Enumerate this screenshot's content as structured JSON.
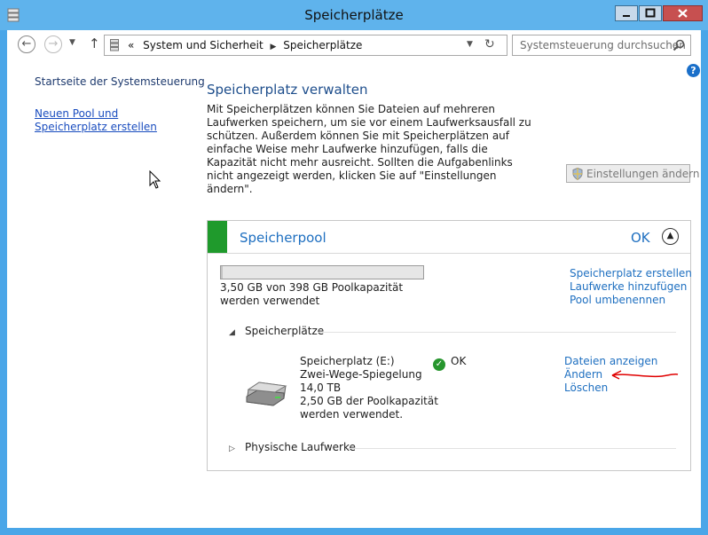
{
  "window": {
    "title": "Speicherplätze"
  },
  "nav": {
    "breadcrumb_prefix": "«",
    "breadcrumb": [
      "System und Sicherheit",
      "Speicherplätze"
    ],
    "search_placeholder": "Systemsteuerung durchsuchen"
  },
  "sidebar": {
    "home": "Startseite der Systemsteuerung",
    "create_link": "Neuen Pool und Speicherplatz erstellen"
  },
  "main": {
    "title": "Speicherplatz verwalten",
    "description": "Mit Speicherplätzen können Sie Dateien auf mehreren Laufwerken speichern, um sie vor einem Laufwerksausfall zu schützen. Außerdem können Sie mit Speicherplätzen auf einfache Weise mehr Laufwerke hinzufügen, falls die Kapazität nicht mehr ausreicht. Sollten die Aufgabenlinks nicht angezeigt werden, klicken Sie auf \"Einstellungen ändern\".",
    "settings_button": "Einstellungen ändern"
  },
  "pool": {
    "title": "Speicherpool",
    "status": "OK",
    "capacity_used_fraction": 0.0088,
    "capacity_text": "3,50 GB von 398 GB Poolkapazität werden verwendet",
    "links": [
      "Speicherplatz erstellen",
      "Laufwerke hinzufügen",
      "Pool umbenennen"
    ],
    "spaces_section": "Speicherplätze",
    "physical_section": "Physische Laufwerke",
    "space": {
      "name": "Speicherplatz (E:)",
      "type": "Zwei-Wege-Spiegelung",
      "size": "14,0 TB",
      "usage_line1": "2,50 GB der Poolkapazität",
      "usage_line2": "werden verwendet.",
      "status": "OK",
      "links": [
        "Dateien anzeigen",
        "Ändern",
        "Löschen"
      ]
    }
  },
  "colors": {
    "titlebar": "#5fb3ec",
    "pool_accent": "#1f9a2c",
    "link": "#1e6fc0",
    "annotation": "#e00000"
  }
}
